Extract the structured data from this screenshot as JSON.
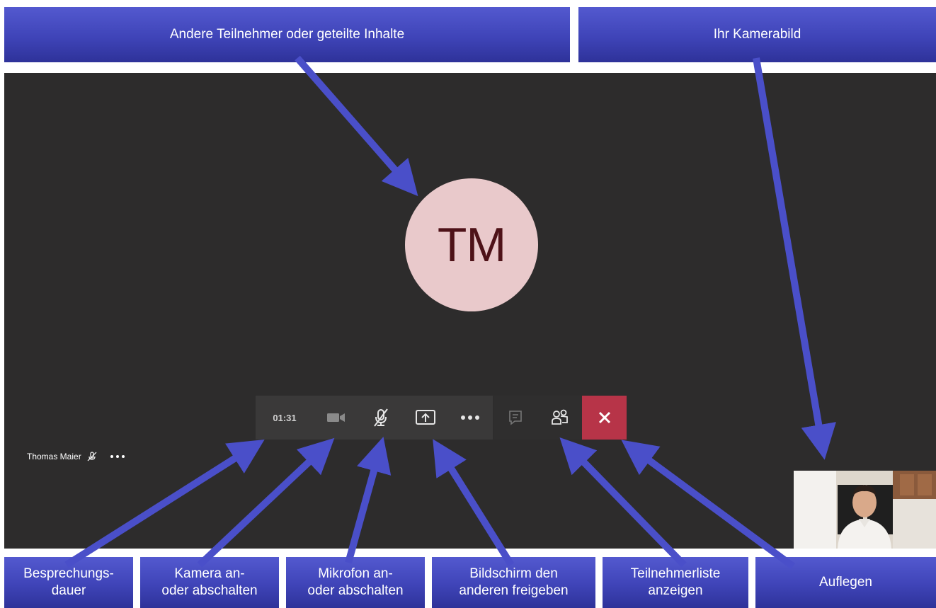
{
  "top_labels": {
    "others": "Andere Teilnehmer oder geteilte Inhalte",
    "camera_view": "Ihr Kamerabild"
  },
  "avatar": {
    "initials": "TM"
  },
  "toolbar": {
    "timer": "01:31",
    "camera_icon": "video-camera-icon",
    "mic_icon": "microphone-muted-icon",
    "share_icon": "share-screen-icon",
    "more_icon": "more-dots-icon",
    "chat_icon": "chat-icon",
    "participants_icon": "participants-icon",
    "hangup_icon": "close-x-icon"
  },
  "participant": {
    "name": "Thomas Maier"
  },
  "bottom_labels": {
    "duration": "Besprechungs-\ndauer",
    "camera": "Kamera an-\noder abschalten",
    "mic": "Mikrofon an-\noder abschalten",
    "share": "Bildschirm den\nanderen freigeben",
    "participants": "Teilnehmerliste\nanzeigen",
    "hangup": "Auflegen"
  },
  "colors": {
    "label_blue": "#4348c0",
    "arrow_blue": "#4a4fc9",
    "stage_bg": "#2d2c2c",
    "avatar_bg": "#e9c9cb",
    "avatar_text": "#4e1218",
    "hangup_red": "#b73448"
  }
}
